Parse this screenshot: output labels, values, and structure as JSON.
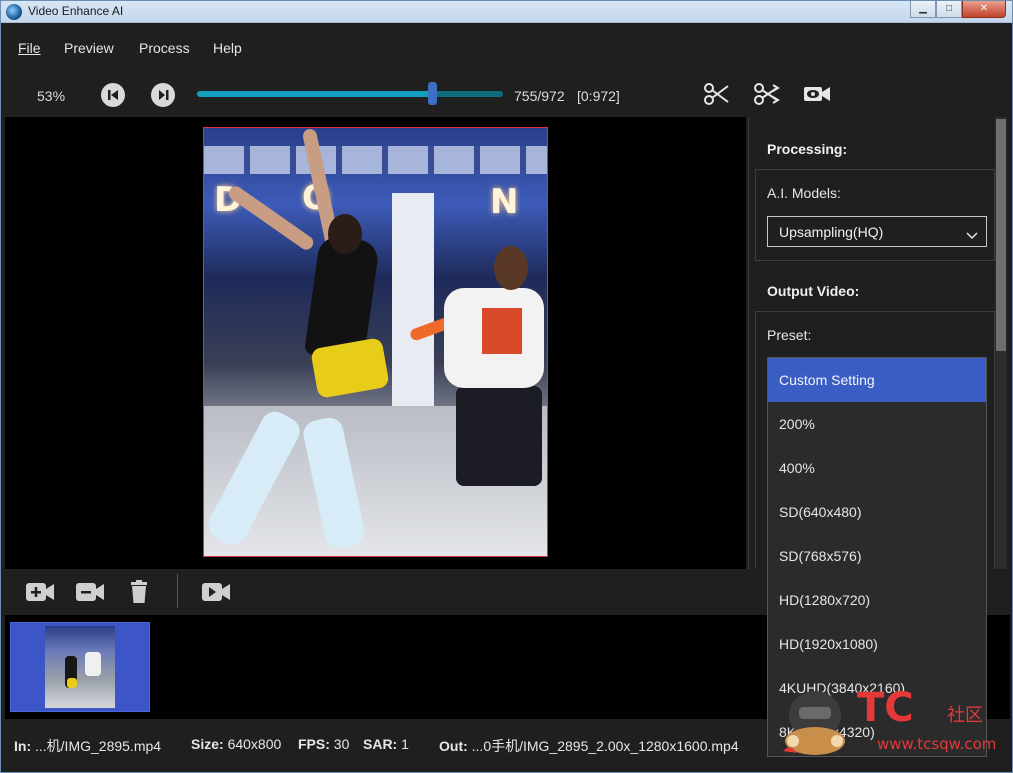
{
  "window": {
    "title": "Video Enhance AI",
    "minimize": "▁",
    "maximize": "□",
    "close": "✕"
  },
  "menu": [
    {
      "label": "File"
    },
    {
      "label": "Preview"
    },
    {
      "label": "Process"
    },
    {
      "label": "Help"
    }
  ],
  "toolbar": {
    "zoom": "53%",
    "frame_position": "755/972",
    "frame_range": "[0:972]",
    "progress_fraction": 0.776,
    "icons": [
      "skip-to-start-icon",
      "play-pause-icon",
      "cut-icon",
      "cut-join-icon",
      "camera-preview-icon"
    ]
  },
  "clip_toolbar": {
    "icons": [
      "add-video-icon",
      "remove-video-icon",
      "trash-icon",
      "video-camera-icon"
    ]
  },
  "preview": {
    "letters": [
      "D",
      "O",
      "N"
    ]
  },
  "status": {
    "in_label": "In:",
    "in_value": "...机/IMG_2895.mp4",
    "size_label": "Size:",
    "size_value": "640x800",
    "fps_label": "FPS:",
    "fps_value": "30",
    "sar_label": "SAR:",
    "sar_value": "1",
    "out_label": "Out:",
    "out_value": "...0手机/IMG_2895_2.00x_1280x1600.mp4"
  },
  "panel": {
    "processing_title": "Processing:",
    "ai_models_label": "A.I. Models:",
    "ai_model_value": "Upsampling(HQ)",
    "output_title": "Output Video:",
    "preset_label": "Preset:"
  },
  "preset_dropdown": {
    "selected": "Custom Setting",
    "options": [
      "Custom Setting",
      "200%",
      "400%",
      "SD(640x480)",
      "SD(768x576)",
      "HD(1280x720)",
      "HD(1920x1080)",
      "4KUHD(3840x2160)",
      "8K(7680x4320)"
    ]
  },
  "watermark": {
    "logo": "TC",
    "site_name": "社区",
    "url": "www.tcsqw.com"
  },
  "colors": {
    "accent": "#3a5dc4",
    "slider": "#139ec0",
    "frame_border": "#e0303a"
  }
}
